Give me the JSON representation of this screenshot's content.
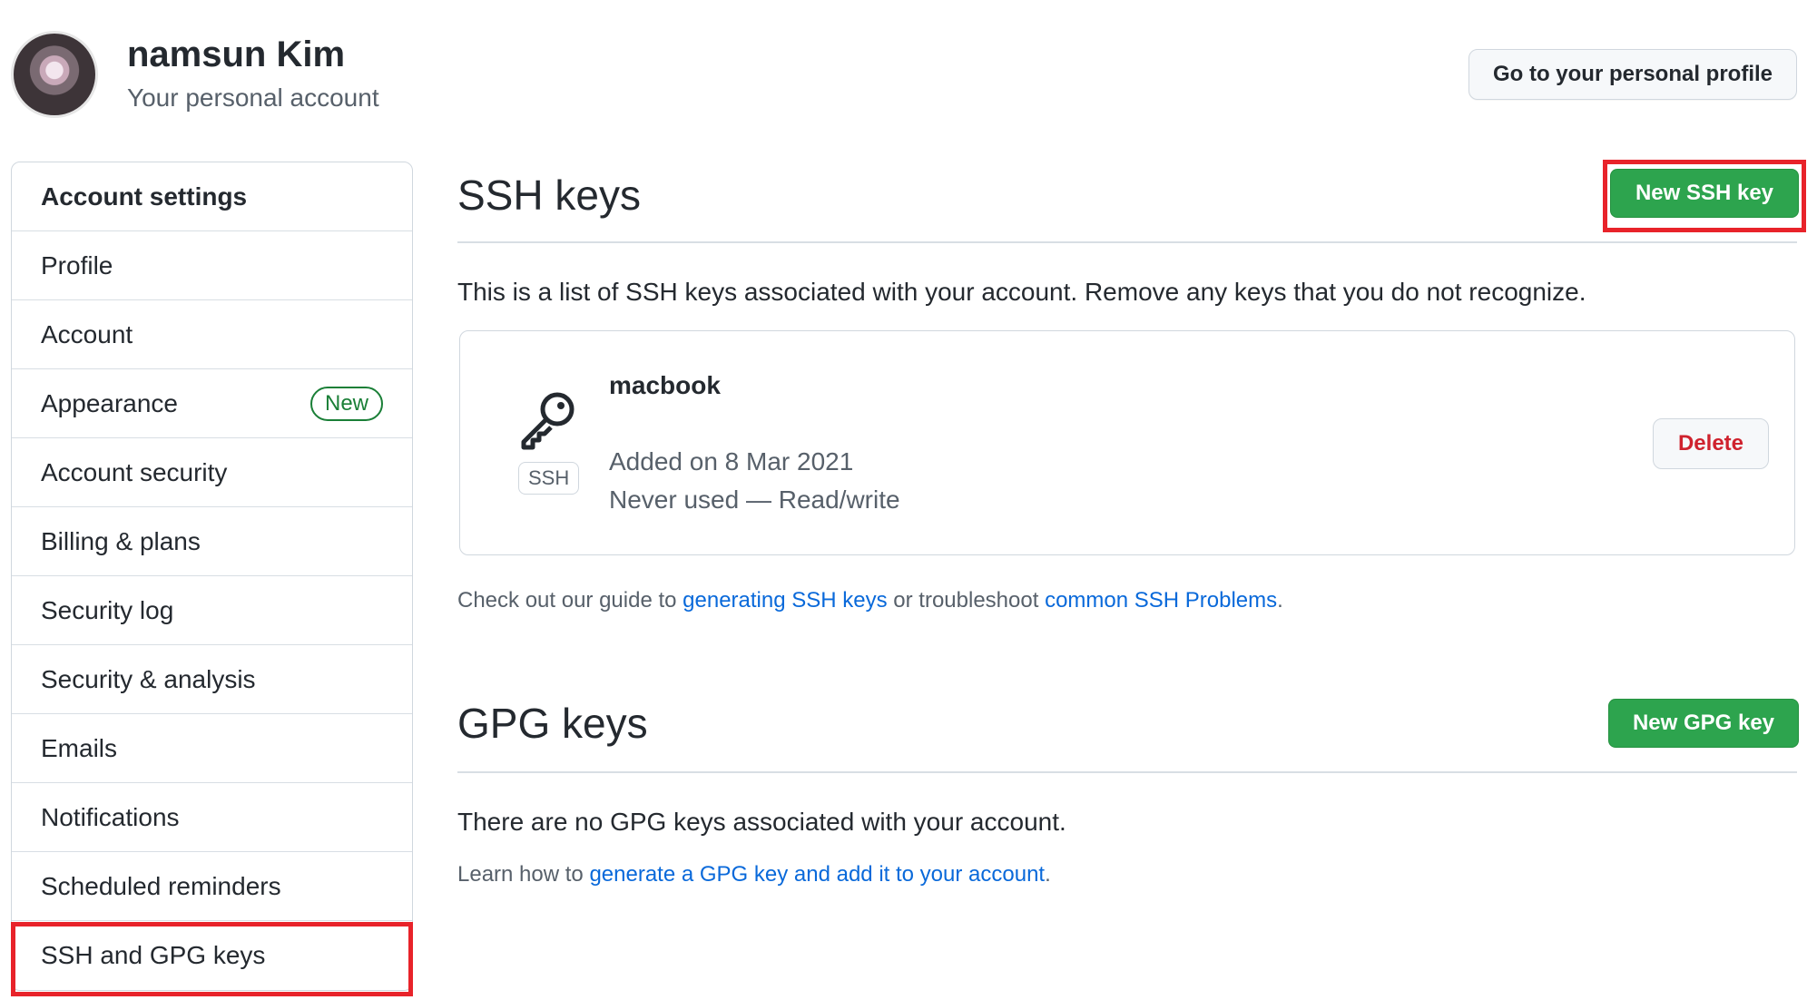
{
  "header": {
    "user_name": "namsun Kim",
    "user_sub": "Your personal account",
    "profile_button": "Go to your personal profile"
  },
  "sidebar": {
    "items": [
      {
        "label": "Account settings"
      },
      {
        "label": "Profile"
      },
      {
        "label": "Account"
      },
      {
        "label": "Appearance",
        "badge": "New"
      },
      {
        "label": "Account security"
      },
      {
        "label": "Billing & plans"
      },
      {
        "label": "Security log"
      },
      {
        "label": "Security & analysis"
      },
      {
        "label": "Emails"
      },
      {
        "label": "Notifications"
      },
      {
        "label": "Scheduled reminders"
      },
      {
        "label": "SSH and GPG keys"
      }
    ]
  },
  "ssh": {
    "title": "SSH keys",
    "new_button": "New SSH key",
    "description": "This is a list of SSH keys associated with your account. Remove any keys that you do not recognize.",
    "key": {
      "name": "macbook",
      "tag": "SSH",
      "added": "Added on 8 Mar 2021",
      "usage": "Never used — Read/write",
      "delete_label": "Delete"
    },
    "guide": {
      "prefix": "Check out our guide to ",
      "link1": "generating SSH keys",
      "middle": " or troubleshoot ",
      "link2": "common SSH Problems",
      "suffix": "."
    }
  },
  "gpg": {
    "title": "GPG keys",
    "new_button": "New GPG key",
    "description": "There are no GPG keys associated with your account.",
    "learn": {
      "prefix": "Learn how to ",
      "link": "generate a GPG key and add it to your account",
      "suffix": "."
    }
  },
  "colors": {
    "primary_green": "#2da44e",
    "link_blue": "#0969da",
    "danger_red": "#cf222e",
    "highlight_red": "#e8232a"
  },
  "icons": {
    "key": "key-icon",
    "avatar": "avatar"
  }
}
